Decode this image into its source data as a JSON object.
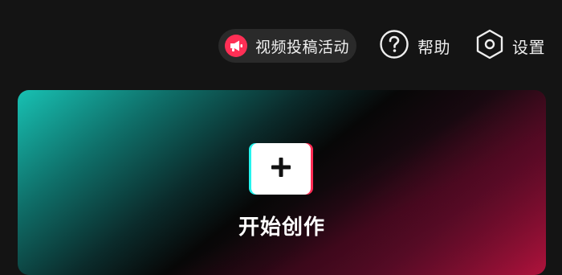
{
  "header": {
    "campaign_label": "视频投稿活动",
    "help_label": "帮助",
    "settings_label": "设置"
  },
  "main": {
    "create_label": "开始创作"
  },
  "icons": {
    "campaign": "megaphone-icon",
    "help": "question-circle-icon",
    "settings": "hexagon-gear-icon",
    "create": "plus-icon"
  },
  "colors": {
    "background": "#141414",
    "pill_background": "#2a2a2a",
    "accent_red": "#ff2f55",
    "accent_cyan": "#25f4ee"
  }
}
